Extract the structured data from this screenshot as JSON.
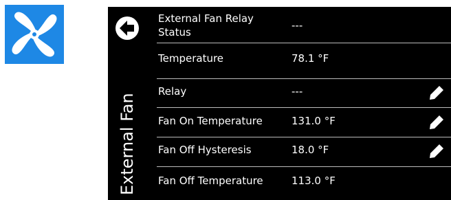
{
  "icon": {
    "name": "fan-icon",
    "tile_color": "#1e88e5",
    "blade_color": "#ffffff"
  },
  "panel": {
    "title": "External Fan",
    "back_icon": "back-arrow-icon",
    "rows": [
      {
        "label": "External Fan Relay Status",
        "value": "---",
        "editable": false
      },
      {
        "label": "Temperature",
        "value": "78.1 °F",
        "editable": false
      },
      {
        "label": "Relay",
        "value": "---",
        "editable": true
      },
      {
        "label": "Fan On Temperature",
        "value": "131.0 °F",
        "editable": true
      },
      {
        "label": "Fan Off Hysteresis",
        "value": "18.0 °F",
        "editable": true
      },
      {
        "label": "Fan Off Temperature",
        "value": "113.0 °F",
        "editable": false
      }
    ],
    "edit_icon": "pencil-icon"
  }
}
